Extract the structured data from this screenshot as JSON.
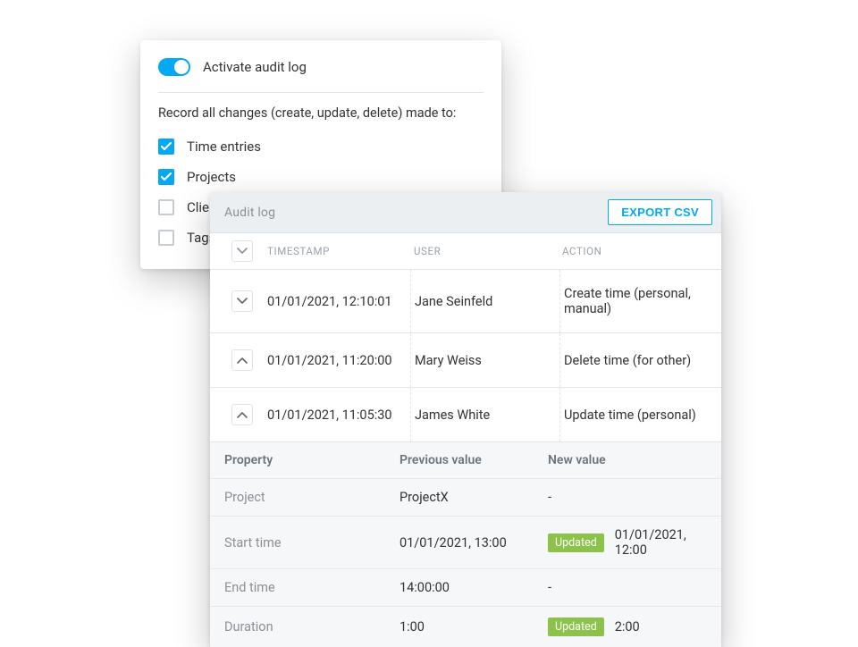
{
  "settings": {
    "toggle_label": "Activate audit log",
    "desc": "Record all changes (create, update, delete) made to:",
    "items": [
      {
        "label": "Time entries",
        "checked": true
      },
      {
        "label": "Projects",
        "checked": true
      },
      {
        "label": "Clients",
        "checked": false
      },
      {
        "label": "Tags",
        "checked": false
      }
    ]
  },
  "audit": {
    "title": "Audit log",
    "export_label": "EXPORT CSV",
    "columns": {
      "timestamp": "TIMESTAMP",
      "user": "USER",
      "action": "ACTION"
    },
    "rows": [
      {
        "expanded": false,
        "timestamp": "01/01/2021, 12:10:01",
        "user": "Jane Seinfeld",
        "action": "Create time (personal, manual)"
      },
      {
        "expanded": true,
        "timestamp": "01/01/2021, 11:20:00",
        "user": "Mary Weiss",
        "action": "Delete time (for other)"
      },
      {
        "expanded": true,
        "timestamp": "01/01/2021, 11:05:30",
        "user": "James White",
        "action": "Update time (personal)"
      }
    ],
    "detail": {
      "headers": {
        "property": "Property",
        "previous": "Previous value",
        "new": "New value"
      },
      "badge": "Updated",
      "rows": [
        {
          "property": "Project",
          "previous": "ProjectX",
          "new": "-",
          "updated": false
        },
        {
          "property": "Start time",
          "previous": "01/01/2021, 13:00",
          "new": "01/01/2021, 12:00",
          "updated": true
        },
        {
          "property": "End time",
          "previous": "14:00:00",
          "new": "-",
          "updated": false
        },
        {
          "property": "Duration",
          "previous": "1:00",
          "new": "2:00",
          "updated": true
        }
      ]
    }
  }
}
